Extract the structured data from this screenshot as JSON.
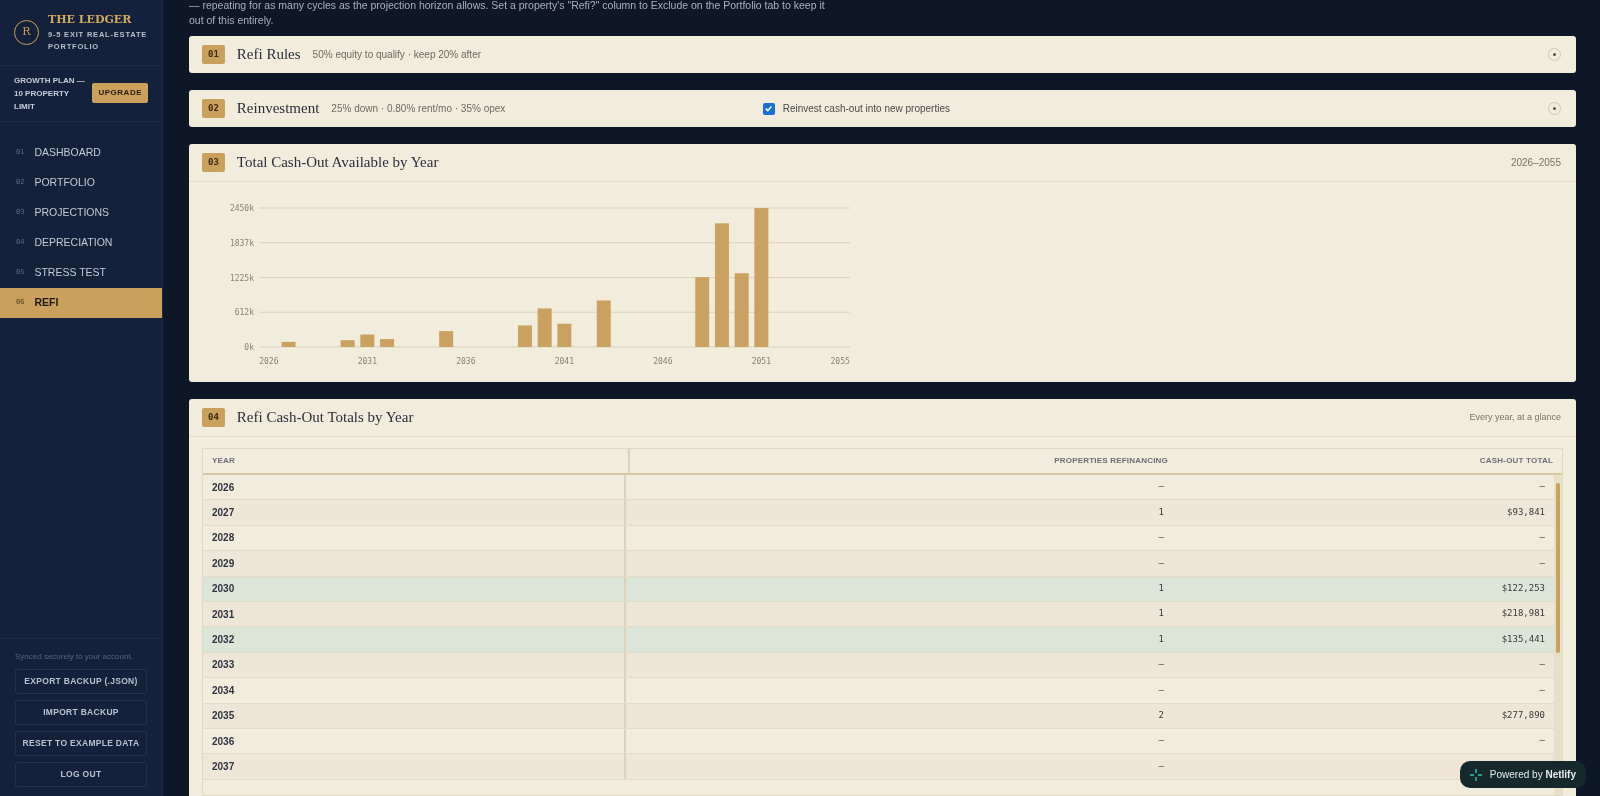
{
  "sidebar": {
    "brand": {
      "mark": "R",
      "title": "THE LEDGER",
      "subtitle": "9-5 EXIT REAL-ESTATE PORTFOLIO"
    },
    "plan": {
      "text": "GROWTH PLAN — 10 PROPERTY LIMIT",
      "button": "UPGRADE"
    },
    "items": [
      {
        "number": "01",
        "label": "DASHBOARD",
        "selected": false
      },
      {
        "number": "02",
        "label": "PORTFOLIO",
        "selected": false
      },
      {
        "number": "03",
        "label": "PROJECTIONS",
        "selected": false
      },
      {
        "number": "04",
        "label": "DEPRECIATION",
        "selected": false
      },
      {
        "number": "05",
        "label": "STRESS TEST",
        "selected": false
      },
      {
        "number": "06",
        "label": "REFI",
        "selected": true
      }
    ],
    "sync_note": "Synced securely to your account.",
    "buttons": [
      "EXPORT BACKUP (.JSON)",
      "IMPORT BACKUP",
      "RESET TO EXAMPLE DATA",
      "LOG OUT"
    ]
  },
  "intro": "— repeating for as many cycles as the projection horizon allows. Set a property's \"Refi?\" column to Exclude on the Portfolio tab to keep it out of this entirely.",
  "sections": [
    {
      "kind": "collapsed",
      "number": "01",
      "title": "Refi Rules",
      "summary": "50% equity to qualify · keep 20% after"
    },
    {
      "kind": "collapsed",
      "number": "02",
      "title": "Reinvestment",
      "summary": "25% down · 0.80% rent/mo · 35% opex",
      "checkbox": {
        "label": "Reinvest cash-out into new properties",
        "checked": true
      }
    },
    {
      "kind": "chart",
      "number": "03",
      "title": "Total Cash-Out Available by Year",
      "note": "2026–2055",
      "chart_data": {
        "type": "bar",
        "grid": true,
        "x": [
          2026,
          2027,
          2028,
          2029,
          2030,
          2031,
          2032,
          2033,
          2034,
          2035,
          2036,
          2037,
          2038,
          2039,
          2040,
          2041,
          2042,
          2043,
          2044,
          2045,
          2046,
          2047,
          2048,
          2049,
          2050,
          2051,
          2052,
          2053,
          2054,
          2055
        ],
        "values": [
          0,
          90000,
          0,
          0,
          120000,
          220000,
          140000,
          0,
          0,
          280000,
          0,
          0,
          0,
          380000,
          680000,
          410000,
          0,
          820000,
          0,
          0,
          0,
          0,
          1230000,
          2180000,
          1300000,
          2450000,
          0,
          0,
          0,
          0
        ],
        "xlim": [
          2025.5,
          2055.5
        ],
        "ylim": [
          0,
          2450000
        ],
        "yticks": [
          {
            "value": 0,
            "label": "0k"
          },
          {
            "value": 612500,
            "label": "612k"
          },
          {
            "value": 1225000,
            "label": "1225k"
          },
          {
            "value": 1837500,
            "label": "1837k"
          },
          {
            "value": 2450000,
            "label": "2450k"
          }
        ],
        "xticks": [
          2026,
          2031,
          2036,
          2041,
          2046,
          2051,
          2055
        ]
      }
    },
    {
      "kind": "table",
      "number": "04",
      "title": "Refi Cash-Out Totals by Year",
      "note": "Every year, at a glance",
      "table": {
        "columns": [
          "YEAR",
          "PROPERTIES REFINANCING",
          "CASH-OUT TOTAL"
        ],
        "rows": [
          {
            "year": "2026",
            "count": "–",
            "total": "–",
            "highlighted": false
          },
          {
            "year": "2027",
            "count": "1",
            "total": "$93,841",
            "highlighted": false
          },
          {
            "year": "2028",
            "count": "–",
            "total": "–",
            "highlighted": false
          },
          {
            "year": "2029",
            "count": "–",
            "total": "–",
            "highlighted": false
          },
          {
            "year": "2030",
            "count": "1",
            "total": "$122,253",
            "highlighted": true
          },
          {
            "year": "2031",
            "count": "1",
            "total": "$218,981",
            "highlighted": false
          },
          {
            "year": "2032",
            "count": "1",
            "total": "$135,441",
            "highlighted": true
          },
          {
            "year": "2033",
            "count": "–",
            "total": "–",
            "highlighted": false
          },
          {
            "year": "2034",
            "count": "–",
            "total": "–",
            "highlighted": false
          },
          {
            "year": "2035",
            "count": "2",
            "total": "$277,890",
            "highlighted": false
          },
          {
            "year": "2036",
            "count": "–",
            "total": "–",
            "highlighted": false
          },
          {
            "year": "2037",
            "count": "–",
            "highlighted": false
          }
        ]
      }
    }
  ],
  "badge": "Powered by **Netlify**"
}
